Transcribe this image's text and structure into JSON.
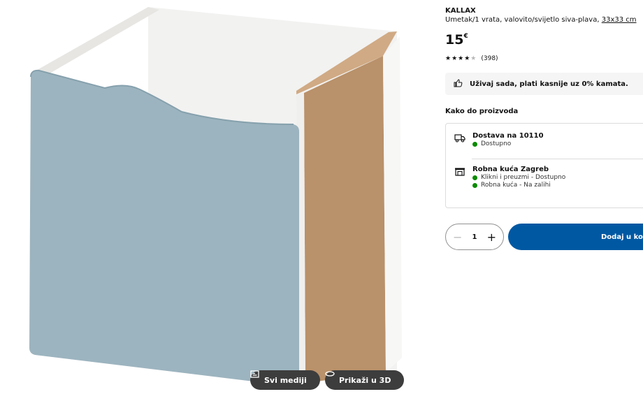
{
  "media": {
    "all_media_label": "Svi mediji",
    "view_3d_label": "Prikaži u 3D"
  },
  "product": {
    "brand": "KALLAX",
    "description": "Umetak/1 vrata, valovito/svijetlo siva-plava,",
    "size": "33x33 cm",
    "price": "15",
    "currency": "€",
    "rating_value": 4.5,
    "review_count": "(398)",
    "pay_later": "Uživaj sada, plati kasnije uz 0% kamata."
  },
  "availability": {
    "heading": "Kako do proizvoda",
    "delivery": {
      "title": "Dostava na 10110",
      "status": "Dostupno"
    },
    "store": {
      "title": "Robna kuća Zagreb",
      "click_collect": "Klikni i preuzmi - Dostupno",
      "in_store": "Robna kuća - Na zalihi"
    }
  },
  "purchase": {
    "quantity": "1",
    "minus": "−",
    "plus": "+",
    "add_to_cart": "Dodaj u košaricu"
  },
  "colors": {
    "accent": "#0058a3",
    "available": "#0a8a00",
    "door": "#9cb4bf"
  }
}
